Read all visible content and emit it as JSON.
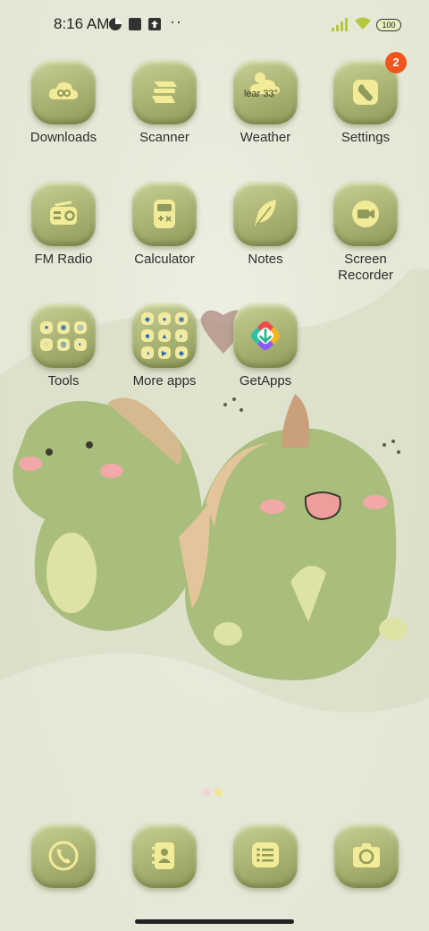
{
  "status_bar": {
    "time": "8:16 AM",
    "left_icons": [
      "data-saver-icon",
      "square-icon",
      "upload-icon"
    ],
    "more": "··",
    "battery": "100"
  },
  "apps": [
    {
      "name": "Downloads",
      "icon": "cloud-download-icon"
    },
    {
      "name": "Scanner",
      "icon": "scanner-icon"
    },
    {
      "name": "Weather",
      "icon": "weather-icon",
      "widget_text": "lear 33°"
    },
    {
      "name": "Settings",
      "icon": "wrench-icon",
      "badge": "2"
    },
    {
      "name": "FM Radio",
      "icon": "radio-icon"
    },
    {
      "name": "Calculator",
      "icon": "calculator-icon"
    },
    {
      "name": "Notes",
      "icon": "feather-icon"
    },
    {
      "name": "Screen Recorder",
      "line1": "Screen",
      "line2": "Recorder",
      "icon": "video-camera-icon"
    },
    {
      "name": "Tools",
      "icon": "folder-icon"
    },
    {
      "name": "More apps",
      "icon": "folder-icon"
    },
    {
      "name": "GetApps",
      "icon": "getapps-icon"
    }
  ],
  "dock": [
    {
      "icon": "phone-icon"
    },
    {
      "icon": "contacts-icon"
    },
    {
      "icon": "messages-icon"
    },
    {
      "icon": "camera-icon"
    }
  ],
  "colors": {
    "badge": "#f0561c",
    "icon_glyph": "#f2ec98",
    "tile": "#a9b273",
    "background": "#e6e9d8"
  }
}
